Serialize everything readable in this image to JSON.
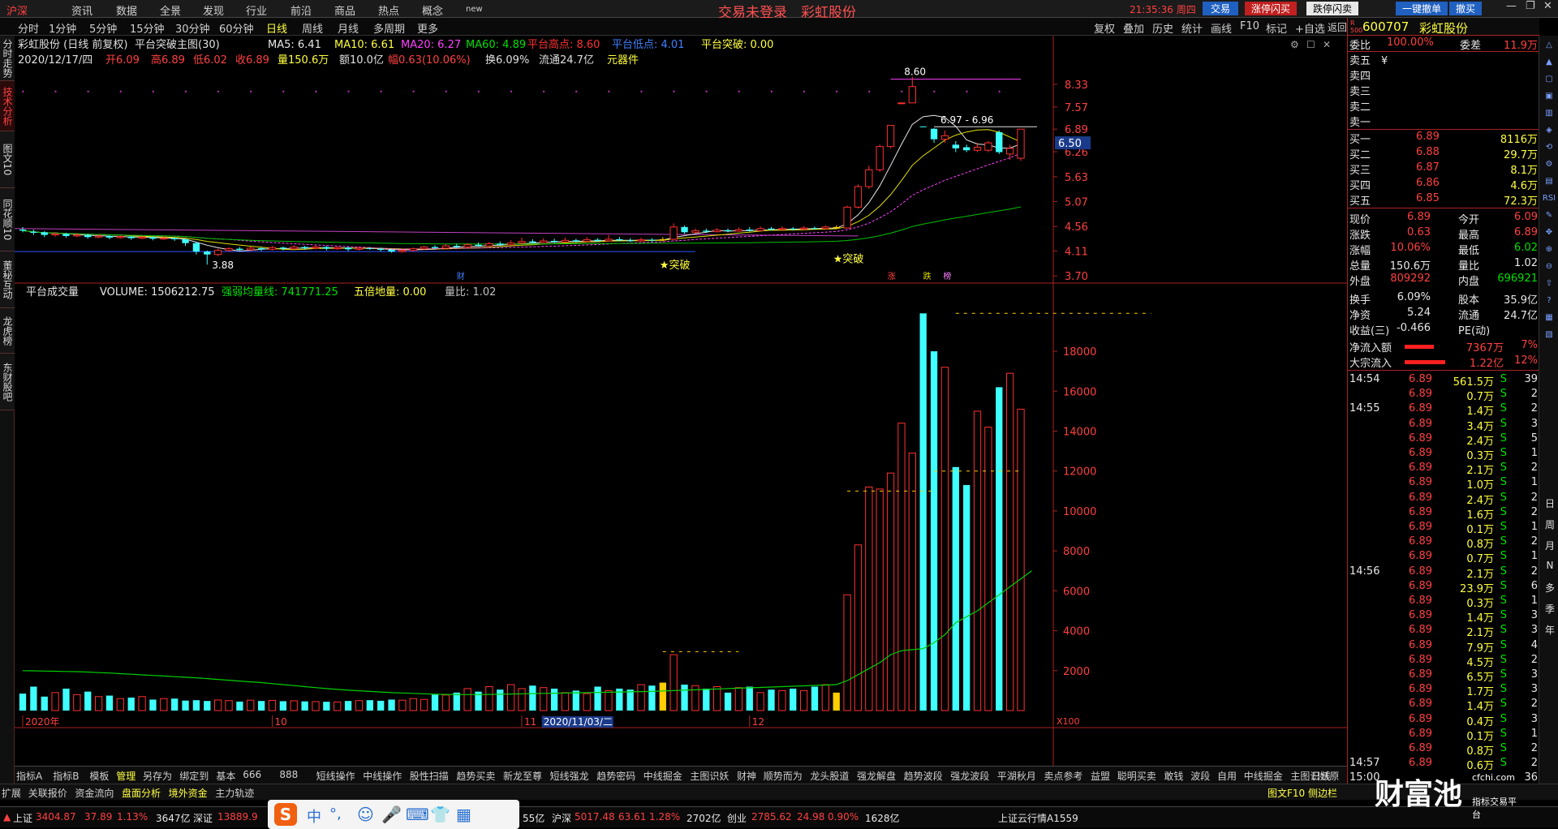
{
  "menu": {
    "items": [
      "沪深",
      "资讯",
      "数据",
      "全景",
      "发现",
      "行业",
      "前沿",
      "商品",
      "热点",
      "概念",
      "new"
    ],
    "center_title": "交易未登录　彩虹股份",
    "clock": "21:35:36 周四",
    "buttons": [
      "交易",
      "涨停闪买",
      "跌停闪卖",
      "一键撤单",
      "撤买"
    ]
  },
  "toolbar": {
    "periods": [
      "分时",
      "1分钟",
      "5分钟",
      "15分钟",
      "30分钟",
      "60分钟",
      "日线",
      "周线",
      "月线",
      "多周期",
      "更多"
    ],
    "right": [
      "复权",
      "叠加",
      "历史",
      "统计",
      "画线",
      "F10",
      "标记",
      "+自选",
      "返回"
    ]
  },
  "left_tabs": [
    "分时走势",
    "技术分析",
    "图文10",
    "同花顺10",
    "董秘互动",
    "龙虎榜",
    "东财股吧"
  ],
  "header1": {
    "title": "彩虹股份 (日线 前复权)",
    "indicator": "平台突破主图(30)",
    "ma5": "MA5: 6.41",
    "ma10": "MA10: 6.61",
    "ma20": "MA20: 6.27",
    "ma60": "MA60: 4.89",
    "high": "平台高点: 8.60",
    "low": "平台低点: 4.01",
    "breakout": "平台突破: 0.00"
  },
  "header2": {
    "date": "2020/12/17/四",
    "open": "开6.09",
    "high": "高6.89",
    "low": "低6.02",
    "close": "收6.89",
    "vol": "量150.6万",
    "amt": "额10.0亿",
    "chg": "幅0.63(10.06%)",
    "turn": "换6.09%",
    "float": "流通24.7亿",
    "concept": "元器件"
  },
  "vol_header": {
    "title": "平台成交量",
    "volume": "VOLUME: 1506212.75",
    "ma": "强弱均量线: 741771.25",
    "five": "五倍地量: 0.00",
    "ratio": "量比: 1.02"
  },
  "chart_data": [
    {
      "type": "candlestick",
      "name": "price",
      "y_ticks": [
        8.33,
        7.57,
        6.89,
        6.26,
        5.63,
        5.07,
        4.56,
        4.11,
        3.7
      ],
      "current_price": "6.50",
      "annotations": [
        "8.60",
        "6.97 - 6.96",
        "3.88",
        "★突破",
        "★突破"
      ],
      "event_marks": [
        "财",
        "涨",
        "跌",
        "榜"
      ],
      "candles": [
        {
          "o": 4.5,
          "c": 4.48,
          "h": 4.55,
          "l": 4.45
        },
        {
          "o": 4.46,
          "c": 4.44,
          "h": 4.5,
          "l": 4.4
        },
        {
          "o": 4.45,
          "c": 4.4,
          "h": 4.47,
          "l": 4.36
        },
        {
          "o": 4.4,
          "c": 4.42,
          "h": 4.45,
          "l": 4.37
        },
        {
          "o": 4.42,
          "c": 4.38,
          "h": 4.44,
          "l": 4.35
        },
        {
          "o": 4.38,
          "c": 4.4,
          "h": 4.43,
          "l": 4.36
        },
        {
          "o": 4.4,
          "c": 4.36,
          "h": 4.42,
          "l": 4.33
        },
        {
          "o": 4.36,
          "c": 4.38,
          "h": 4.41,
          "l": 4.34
        },
        {
          "o": 4.38,
          "c": 4.35,
          "h": 4.4,
          "l": 4.32
        },
        {
          "o": 4.35,
          "c": 4.37,
          "h": 4.39,
          "l": 4.33
        },
        {
          "o": 4.37,
          "c": 4.34,
          "h": 4.38,
          "l": 4.31
        },
        {
          "o": 4.34,
          "c": 4.36,
          "h": 4.38,
          "l": 4.32
        },
        {
          "o": 4.36,
          "c": 4.33,
          "h": 4.37,
          "l": 4.3
        },
        {
          "o": 4.33,
          "c": 4.34,
          "h": 4.36,
          "l": 4.31
        },
        {
          "o": 4.34,
          "c": 4.32,
          "h": 4.35,
          "l": 4.29
        },
        {
          "o": 4.32,
          "c": 4.25,
          "h": 4.33,
          "l": 4.2
        },
        {
          "o": 4.25,
          "c": 4.1,
          "h": 4.27,
          "l": 4.05
        },
        {
          "o": 4.1,
          "c": 4.05,
          "h": 4.12,
          "l": 3.88
        },
        {
          "o": 4.05,
          "c": 4.12,
          "h": 4.15,
          "l": 4.02
        },
        {
          "o": 4.12,
          "c": 4.15,
          "h": 4.18,
          "l": 4.1
        },
        {
          "o": 4.15,
          "c": 4.13,
          "h": 4.18,
          "l": 4.1
        },
        {
          "o": 4.13,
          "c": 4.16,
          "h": 4.19,
          "l": 4.11
        },
        {
          "o": 4.16,
          "c": 4.14,
          "h": 4.18,
          "l": 4.11
        },
        {
          "o": 4.14,
          "c": 4.17,
          "h": 4.2,
          "l": 4.12
        },
        {
          "o": 4.17,
          "c": 4.15,
          "h": 4.19,
          "l": 4.12
        },
        {
          "o": 4.15,
          "c": 4.18,
          "h": 4.21,
          "l": 4.13
        },
        {
          "o": 4.18,
          "c": 4.16,
          "h": 4.2,
          "l": 4.13
        },
        {
          "o": 4.16,
          "c": 4.18,
          "h": 4.22,
          "l": 4.14
        },
        {
          "o": 4.18,
          "c": 4.15,
          "h": 4.2,
          "l": 4.12
        },
        {
          "o": 4.15,
          "c": 4.17,
          "h": 4.19,
          "l": 4.13
        },
        {
          "o": 4.17,
          "c": 4.14,
          "h": 4.18,
          "l": 4.11
        },
        {
          "o": 4.14,
          "c": 4.16,
          "h": 4.19,
          "l": 4.12
        },
        {
          "o": 4.16,
          "c": 4.15,
          "h": 4.18,
          "l": 4.13
        },
        {
          "o": 4.15,
          "c": 4.13,
          "h": 4.17,
          "l": 4.1
        },
        {
          "o": 4.13,
          "c": 4.1,
          "h": 4.15,
          "l": 4.08
        },
        {
          "o": 4.1,
          "c": 4.12,
          "h": 4.15,
          "l": 4.08
        },
        {
          "o": 4.12,
          "c": 4.15,
          "h": 4.17,
          "l": 4.1
        },
        {
          "o": 4.15,
          "c": 4.18,
          "h": 4.2,
          "l": 4.13
        },
        {
          "o": 4.18,
          "c": 4.16,
          "h": 4.21,
          "l": 4.14
        },
        {
          "o": 4.16,
          "c": 4.2,
          "h": 4.23,
          "l": 4.15
        },
        {
          "o": 4.2,
          "c": 4.18,
          "h": 4.24,
          "l": 4.16
        },
        {
          "o": 4.18,
          "c": 4.22,
          "h": 4.25,
          "l": 4.17
        },
        {
          "o": 4.22,
          "c": 4.2,
          "h": 4.26,
          "l": 4.18
        },
        {
          "o": 4.2,
          "c": 4.24,
          "h": 4.27,
          "l": 4.19
        },
        {
          "o": 4.24,
          "c": 4.22,
          "h": 4.28,
          "l": 4.2
        },
        {
          "o": 4.22,
          "c": 4.25,
          "h": 4.3,
          "l": 4.21
        },
        {
          "o": 4.25,
          "c": 4.28,
          "h": 4.35,
          "l": 4.23
        },
        {
          "o": 4.28,
          "c": 4.26,
          "h": 4.32,
          "l": 4.24
        },
        {
          "o": 4.26,
          "c": 4.29,
          "h": 4.34,
          "l": 4.25
        },
        {
          "o": 4.29,
          "c": 4.27,
          "h": 4.33,
          "l": 4.25
        },
        {
          "o": 4.27,
          "c": 4.3,
          "h": 4.35,
          "l": 4.26
        },
        {
          "o": 4.3,
          "c": 4.28,
          "h": 4.33,
          "l": 4.26
        },
        {
          "o": 4.28,
          "c": 4.31,
          "h": 4.36,
          "l": 4.27
        },
        {
          "o": 4.31,
          "c": 4.29,
          "h": 4.34,
          "l": 4.27
        },
        {
          "o": 4.29,
          "c": 4.32,
          "h": 4.4,
          "l": 4.28
        },
        {
          "o": 4.32,
          "c": 4.3,
          "h": 4.36,
          "l": 4.28
        },
        {
          "o": 4.3,
          "c": 4.29,
          "h": 4.34,
          "l": 4.27
        },
        {
          "o": 4.29,
          "c": 4.31,
          "h": 4.35,
          "l": 4.27
        },
        {
          "o": 4.31,
          "c": 4.3,
          "h": 4.34,
          "l": 4.28
        },
        {
          "o": 4.3,
          "c": 4.32,
          "h": 4.36,
          "l": 4.28
        },
        {
          "o": 4.32,
          "c": 4.55,
          "h": 4.62,
          "l": 4.3
        },
        {
          "o": 4.55,
          "c": 4.45,
          "h": 4.58,
          "l": 4.42
        },
        {
          "o": 4.45,
          "c": 4.48,
          "h": 4.52,
          "l": 4.43
        },
        {
          "o": 4.48,
          "c": 4.46,
          "h": 4.52,
          "l": 4.44
        },
        {
          "o": 4.46,
          "c": 4.49,
          "h": 4.53,
          "l": 4.45
        },
        {
          "o": 4.49,
          "c": 4.47,
          "h": 4.52,
          "l": 4.45
        },
        {
          "o": 4.47,
          "c": 4.5,
          "h": 4.54,
          "l": 4.46
        },
        {
          "o": 4.5,
          "c": 4.48,
          "h": 4.55,
          "l": 4.46
        },
        {
          "o": 4.48,
          "c": 4.52,
          "h": 4.56,
          "l": 4.47
        },
        {
          "o": 4.52,
          "c": 4.5,
          "h": 4.55,
          "l": 4.48
        },
        {
          "o": 4.5,
          "c": 4.52,
          "h": 4.56,
          "l": 4.48
        },
        {
          "o": 4.52,
          "c": 4.51,
          "h": 4.55,
          "l": 4.48
        },
        {
          "o": 4.51,
          "c": 4.53,
          "h": 4.57,
          "l": 4.49
        },
        {
          "o": 4.53,
          "c": 4.52,
          "h": 4.56,
          "l": 4.5
        },
        {
          "o": 4.52,
          "c": 4.55,
          "h": 4.58,
          "l": 4.5
        },
        {
          "o": 4.55,
          "c": 4.53,
          "h": 4.58,
          "l": 4.51
        },
        {
          "o": 4.53,
          "c": 4.95,
          "h": 4.98,
          "l": 4.52
        },
        {
          "o": 4.95,
          "c": 5.4,
          "h": 5.45,
          "l": 4.92
        },
        {
          "o": 5.4,
          "c": 5.8,
          "h": 5.9,
          "l": 5.35
        },
        {
          "o": 5.8,
          "c": 6.4,
          "h": 6.45,
          "l": 5.75
        },
        {
          "o": 6.4,
          "c": 7.0,
          "h": 7.0,
          "l": 6.35
        },
        {
          "o": 7.7,
          "c": 7.7,
          "h": 7.7,
          "l": 7.7
        },
        {
          "o": 7.7,
          "c": 8.25,
          "h": 8.6,
          "l": 7.7
        },
        {
          "o": 6.97,
          "c": 6.96,
          "h": 6.97,
          "l": 6.96
        },
        {
          "o": 6.9,
          "c": 6.6,
          "h": 6.92,
          "l": 6.5
        },
        {
          "o": 6.6,
          "c": 6.7,
          "h": 6.85,
          "l": 6.5
        },
        {
          "o": 6.45,
          "c": 6.35,
          "h": 6.55,
          "l": 6.25
        },
        {
          "o": 6.38,
          "c": 6.3,
          "h": 6.45,
          "l": 6.25
        },
        {
          "o": 6.3,
          "c": 6.38,
          "h": 6.5,
          "l": 6.25
        },
        {
          "o": 6.3,
          "c": 6.5,
          "h": 6.55,
          "l": 6.25
        },
        {
          "o": 6.8,
          "c": 6.25,
          "h": 6.85,
          "l": 6.2
        },
        {
          "o": 6.2,
          "c": 6.35,
          "h": 6.45,
          "l": 6.05
        },
        {
          "o": 6.09,
          "c": 6.89,
          "h": 6.89,
          "l": 6.02
        }
      ]
    },
    {
      "type": "bar",
      "name": "volume",
      "y_ticks": [
        18000,
        16000,
        14000,
        12000,
        10000,
        8000,
        6000,
        4000,
        2000
      ],
      "unit": "X100",
      "x_labels": [
        "2020年",
        "10",
        "11",
        "2020/11/03/二",
        "12"
      ],
      "values": [
        850,
        1200,
        700,
        900,
        1100,
        800,
        950,
        700,
        750,
        600,
        650,
        700,
        550,
        600,
        600,
        500,
        520,
        480,
        530,
        500,
        450,
        520,
        480,
        510,
        470,
        490,
        460,
        450,
        440,
        430,
        480,
        500,
        520,
        490,
        550,
        520,
        600,
        560,
        800,
        780,
        900,
        1100,
        950,
        1200,
        1050,
        1300,
        1100,
        1250,
        1150,
        1100,
        900,
        1000,
        850,
        1200,
        1000,
        1100,
        1050,
        1300,
        1250,
        1400,
        2800,
        1300,
        1250,
        1100,
        1200,
        900,
        1150,
        1200,
        900,
        1050,
        1000,
        1100,
        1000,
        1200,
        1300,
        900,
        5800,
        8300,
        11200,
        11100,
        11900,
        14400,
        12900,
        19900,
        18000,
        17200,
        12200,
        11300,
        15000,
        14200,
        16200,
        16900,
        15100
      ],
      "ma": [
        2000,
        1990,
        1980,
        1970,
        1960,
        1950,
        1930,
        1900,
        1880,
        1850,
        1820,
        1790,
        1760,
        1730,
        1700,
        1670,
        1640,
        1600,
        1560,
        1520,
        1480,
        1440,
        1400,
        1350,
        1300,
        1250,
        1200,
        1150,
        1100,
        1060,
        1020,
        990,
        960,
        930,
        900,
        880,
        860,
        840,
        820,
        810,
        800,
        800,
        800,
        810,
        820,
        830,
        840,
        850,
        860,
        870,
        880,
        890,
        900,
        910,
        920,
        930,
        940,
        950,
        960,
        980,
        1000,
        1020,
        1040,
        1060,
        1080,
        1100,
        1120,
        1140,
        1160,
        1180,
        1200,
        1220,
        1240,
        1260,
        1280,
        1300,
        1500,
        1800,
        2100,
        2400,
        2800,
        3000,
        3050,
        3100,
        3400,
        3800,
        4400,
        4700,
        5000,
        5400,
        5800,
        6200,
        6600,
        7000
      ]
    }
  ],
  "quote": {
    "code": "600707",
    "name": "彩虹股份",
    "weibi": "100.00%",
    "weicha": "11.9万",
    "sell": [
      "卖五",
      "卖四",
      "卖三",
      "卖二",
      "卖一"
    ],
    "buy": [
      {
        "label": "买一",
        "price": "6.89",
        "vol": "8116万"
      },
      {
        "label": "买二",
        "price": "6.88",
        "vol": "29.7万"
      },
      {
        "label": "买三",
        "price": "6.87",
        "vol": "8.1万"
      },
      {
        "label": "买四",
        "price": "6.86",
        "vol": "4.6万"
      },
      {
        "label": "买五",
        "price": "6.85",
        "vol": "72.3万"
      }
    ],
    "stats": [
      [
        "现价",
        "6.89",
        "今开",
        "6.09"
      ],
      [
        "涨跌",
        "0.63",
        "最高",
        "6.89"
      ],
      [
        "涨幅",
        "10.06%",
        "最低",
        "6.02"
      ],
      [
        "总量",
        "150.6万",
        "量比",
        "1.02"
      ],
      [
        "外盘",
        "809292",
        "内盘",
        "696921"
      ],
      [
        "换手",
        "6.09%",
        "股本",
        "35.9亿"
      ],
      [
        "净资",
        "5.24",
        "流通",
        "24.7亿"
      ],
      [
        "收益(三)",
        "-0.466",
        "PE(动)",
        ""
      ]
    ],
    "flow": [
      [
        "净流入额",
        "7367万",
        "7%"
      ],
      [
        "大宗流入",
        "1.22亿",
        "12%"
      ]
    ],
    "ticks": [
      [
        "14:54",
        "6.89",
        "561.5万",
        "S",
        "39"
      ],
      [
        "",
        "6.89",
        "0.7万",
        "S",
        "2"
      ],
      [
        "14:55",
        "6.89",
        "1.4万",
        "S",
        "2"
      ],
      [
        "",
        "6.89",
        "3.4万",
        "S",
        "3"
      ],
      [
        "",
        "6.89",
        "2.4万",
        "S",
        "5"
      ],
      [
        "",
        "6.89",
        "0.3万",
        "S",
        "1"
      ],
      [
        "",
        "6.89",
        "2.1万",
        "S",
        "2"
      ],
      [
        "",
        "6.89",
        "1.0万",
        "S",
        "1"
      ],
      [
        "",
        "6.89",
        "2.4万",
        "S",
        "2"
      ],
      [
        "",
        "6.89",
        "1.6万",
        "S",
        "2"
      ],
      [
        "",
        "6.89",
        "0.1万",
        "S",
        "1"
      ],
      [
        "",
        "6.89",
        "0.8万",
        "S",
        "2"
      ],
      [
        "",
        "6.89",
        "0.7万",
        "S",
        "1"
      ],
      [
        "14:56",
        "6.89",
        "2.1万",
        "S",
        "2"
      ],
      [
        "",
        "6.89",
        "23.9万",
        "S",
        "6"
      ],
      [
        "",
        "6.89",
        "0.3万",
        "S",
        "1"
      ],
      [
        "",
        "6.89",
        "1.4万",
        "S",
        "3"
      ],
      [
        "",
        "6.89",
        "2.1万",
        "S",
        "3"
      ],
      [
        "",
        "6.89",
        "7.9万",
        "S",
        "4"
      ],
      [
        "",
        "6.89",
        "4.5万",
        "S",
        "2"
      ],
      [
        "",
        "6.89",
        "6.5万",
        "S",
        "3"
      ],
      [
        "",
        "6.89",
        "1.7万",
        "S",
        "3"
      ],
      [
        "",
        "6.89",
        "1.4万",
        "S",
        "2"
      ],
      [
        "",
        "6.89",
        "0.4万",
        "S",
        "3"
      ],
      [
        "",
        "6.89",
        "0.1万",
        "S",
        "1"
      ],
      [
        "",
        "6.89",
        "0.8万",
        "S",
        "2"
      ],
      [
        "14:57",
        "6.89",
        "0.6万",
        "S",
        "2"
      ],
      [
        "15:00",
        "",
        "",
        "",
        "36"
      ]
    ]
  },
  "right_strip": [
    "日",
    "周",
    "月",
    "N",
    "多",
    "季",
    "年"
  ],
  "bottom_tabs": [
    "指标A",
    "指标B",
    "模板",
    "管理",
    "另存为",
    "绑定到",
    "基本",
    "666",
    "888",
    "短线操作",
    "中线操作",
    "股性扫描",
    "趋势买卖",
    "新龙至尊",
    "短线强龙",
    "趋势密码",
    "中线掘金",
    "主图识妖",
    "财神",
    "顺势而为",
    "龙头股道",
    "强龙解盘",
    "趋势波段",
    "强龙波段",
    "平湖秋月",
    "卖点参考",
    "益盟",
    "聪明买卖",
    "敢钱",
    "波段",
    "自用",
    "中线掘金",
    "主图识妖原"
  ],
  "bottom_tabs2": [
    "扩展",
    "关联报价",
    "资金流向",
    "盘面分析",
    "境外资金",
    "主力轨迹"
  ],
  "bottom_right": [
    "日线",
    "图文F10",
    "侧边栏"
  ],
  "status": {
    "sh": "上证",
    "sh_val": "3404.87",
    "sh_chg": "37.89",
    "sh_pct": "1.13%",
    "sh_amt": "3647亿",
    "sz": "深证",
    "sz_val": "13889.9",
    "sz_amt": "55亿",
    "hs": "沪深",
    "hs_val": "5017.48",
    "hs_chg": "63.61",
    "hs_pct": "1.28%",
    "hs_amt": "2702亿",
    "cy": "创业",
    "cy_val": "2785.62",
    "cy_chg": "24.98",
    "cy_pct": "0.90%",
    "cy_amt": "1628亿",
    "cloud": "上证云行情A1559"
  },
  "brand": {
    "logo": "财富池",
    "url": "cfchi.com",
    "sub": "指标交易平台"
  }
}
